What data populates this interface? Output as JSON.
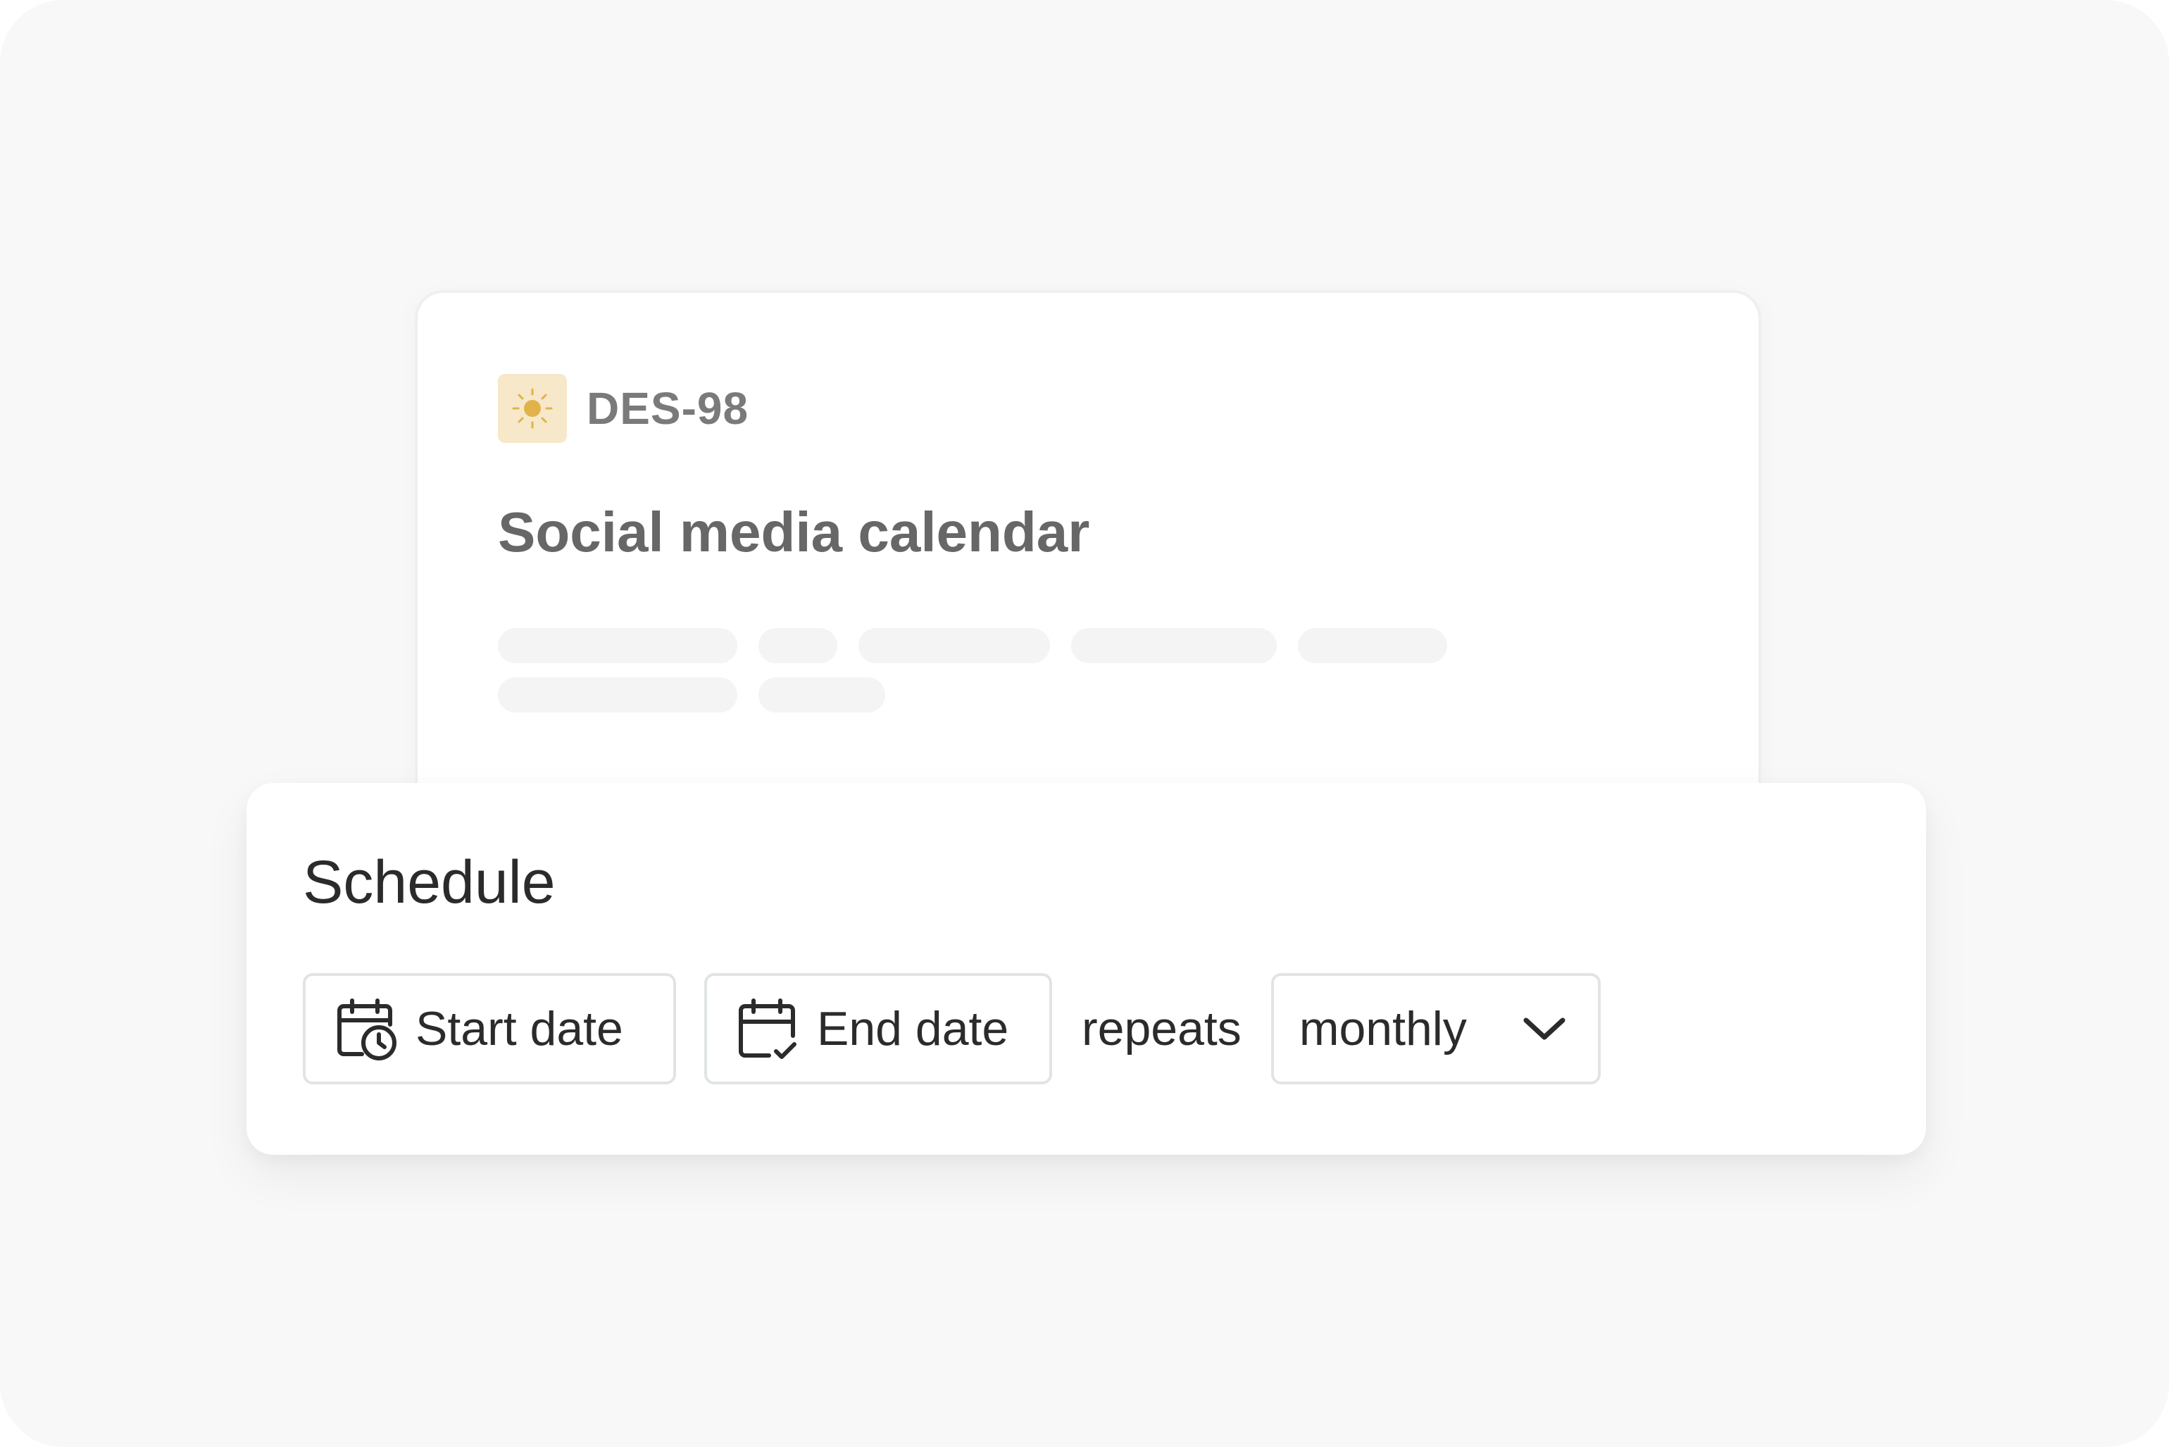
{
  "issue": {
    "id": "DES-98",
    "title": "Social media calendar",
    "icon": "sun-icon",
    "icon_bg": "#f6e8c9",
    "icon_color": "#e2b24a"
  },
  "schedule": {
    "title": "Schedule",
    "start_label": "Start date",
    "start_icon": "calendar-clock-icon",
    "end_label": "End date",
    "end_icon": "calendar-check-icon",
    "repeats_label": "repeats",
    "frequency": {
      "selected": "monthly",
      "icon": "chevron-down-icon"
    }
  }
}
